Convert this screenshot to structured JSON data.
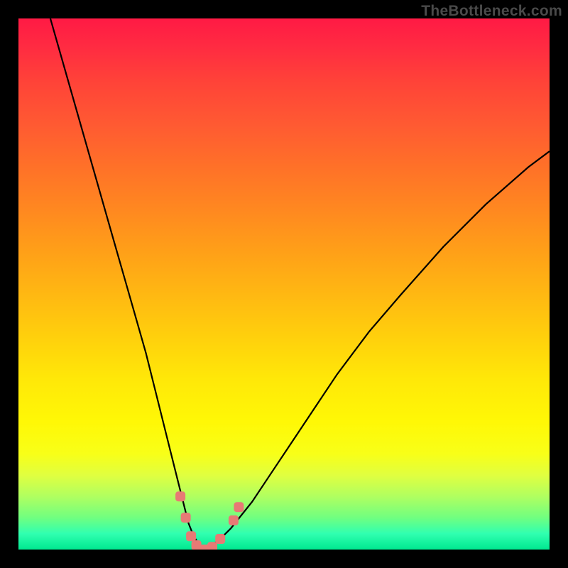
{
  "watermark": "TheBottleneck.com",
  "chart_data": {
    "type": "line",
    "title": "",
    "xlabel": "",
    "ylabel": "",
    "xlim": [
      0,
      100
    ],
    "ylim": [
      0,
      100
    ],
    "description": "Bottleneck V-curve: two branches descending from high bottleneck (red, top) to a minimum near zero (green, bottom) at the balanced point, then rising again. Left branch is steeper than right. Highlighted pink/salmon markers cluster around the minimum.",
    "series": [
      {
        "name": "left-branch",
        "x": [
          6,
          10,
          14,
          18,
          20,
          22,
          24,
          26,
          28,
          30,
          31,
          32,
          33,
          34,
          35
        ],
        "y": [
          100,
          86,
          72,
          58,
          51,
          44,
          37,
          29,
          21,
          13,
          9,
          5,
          2.5,
          1,
          0
        ]
      },
      {
        "name": "right-branch",
        "x": [
          35,
          36,
          38,
          40,
          44,
          48,
          52,
          56,
          60,
          66,
          72,
          80,
          88,
          96,
          100
        ],
        "y": [
          0,
          0.5,
          2,
          4,
          9,
          15,
          21,
          27,
          33,
          41,
          48,
          57,
          65,
          72,
          75
        ]
      }
    ],
    "markers": [
      {
        "x": 30.5,
        "y": 10,
        "style": "salmon-square"
      },
      {
        "x": 31.5,
        "y": 6,
        "style": "salmon-square"
      },
      {
        "x": 32.5,
        "y": 2.5,
        "style": "salmon-square"
      },
      {
        "x": 33.5,
        "y": 0.8,
        "style": "salmon-square"
      },
      {
        "x": 35,
        "y": 0,
        "style": "salmon-square"
      },
      {
        "x": 36.5,
        "y": 0.5,
        "style": "salmon-square"
      },
      {
        "x": 38,
        "y": 2,
        "style": "salmon-square"
      },
      {
        "x": 40.5,
        "y": 5.5,
        "style": "salmon-square"
      },
      {
        "x": 41.5,
        "y": 8,
        "style": "salmon-square"
      }
    ],
    "gradient_meaning": "Vertical axis color maps bottleneck severity: red=high, yellow=medium, green=low/balanced",
    "minimum_x": 35
  },
  "colors": {
    "marker_fill": "#e77a75",
    "curve_stroke": "#000000",
    "background": "#000000"
  }
}
